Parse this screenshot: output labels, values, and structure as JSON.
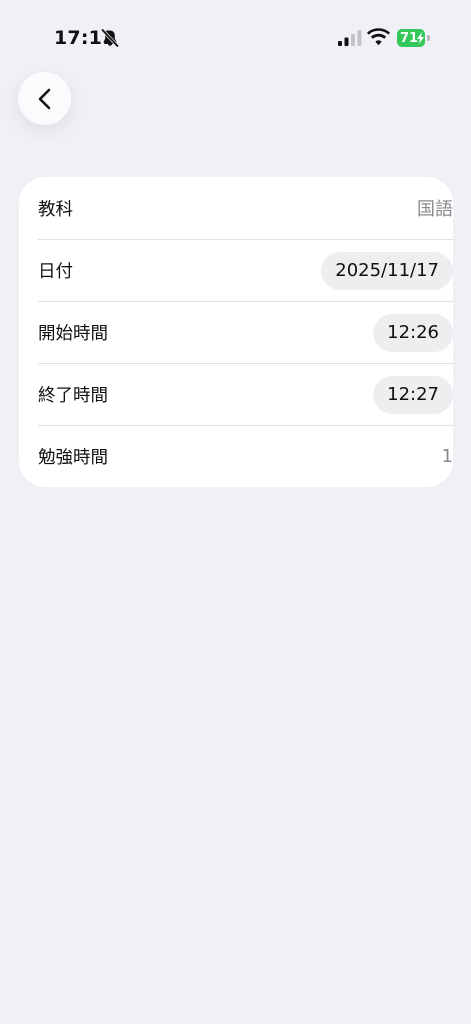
{
  "status_bar": {
    "time": "17:11",
    "battery_level": "71",
    "icons": [
      "bell-slash-icon",
      "cellular-signal-icon",
      "wifi-icon",
      "battery-charging-icon"
    ],
    "battery_color": "#34c759"
  },
  "nav": {
    "back_icon": "chevron-left-icon"
  },
  "form": {
    "rows": [
      {
        "label": "教科",
        "value": "国語",
        "style": "plain"
      },
      {
        "label": "日付",
        "value": "2025/11/17",
        "style": "pill"
      },
      {
        "label": "開始時間",
        "value": "12:26",
        "style": "pill"
      },
      {
        "label": "終了時間",
        "value": "12:27",
        "style": "pill"
      },
      {
        "label": "勉強時間",
        "value": "1",
        "style": "plain"
      }
    ]
  },
  "colors": {
    "background": "#f1f0f6",
    "card": "#ffffff",
    "pill": "#eeeef0",
    "secondary_text": "#8a8a8e"
  }
}
